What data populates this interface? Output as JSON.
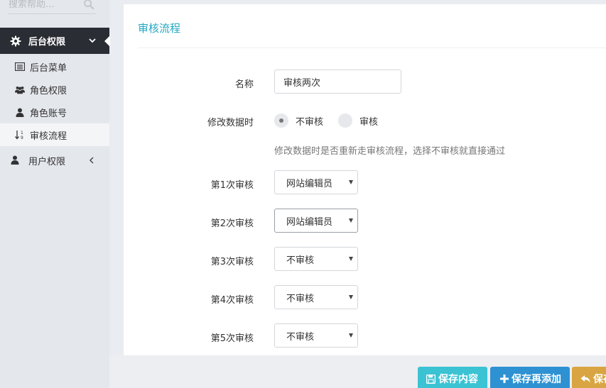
{
  "search": {
    "placeholder": "搜索帮助..."
  },
  "sidebar": {
    "group_active": {
      "label": "后台权限"
    },
    "items": [
      {
        "label": "后台菜单",
        "icon": "list-icon"
      },
      {
        "label": "角色权限",
        "icon": "users-icon"
      },
      {
        "label": "角色账号",
        "icon": "user-icon"
      },
      {
        "label": "审核流程",
        "icon": "sort-numeric-icon",
        "selected": true
      }
    ],
    "group2": {
      "label": "用户权限"
    }
  },
  "panel": {
    "title": "审核流程",
    "name_label": "名称",
    "name_value": "审核两次",
    "modify_label": "修改数据时",
    "radio_options": [
      "不审核",
      "审核"
    ],
    "radio_selected": "不审核",
    "hint": "修改数据时是否重新走审核流程，选择不审核就直接通过",
    "review_rows": [
      {
        "label": "第1次审核",
        "value": "网站编辑员"
      },
      {
        "label": "第2次审核",
        "value": "网站编辑员"
      },
      {
        "label": "第3次审核",
        "value": "不审核"
      },
      {
        "label": "第4次审核",
        "value": "不审核"
      },
      {
        "label": "第5次审核",
        "value": "不审核"
      }
    ]
  },
  "footer": {
    "save_label": "保存内容",
    "save_add_label": "保存再添加",
    "back_label": "保存"
  },
  "colors": {
    "title": "#23a8c3",
    "sidebar_active": "#2a2d33",
    "save_button": "#3bc3d3",
    "save_add_button": "#2d91d2",
    "back_button": "#d8a542"
  }
}
